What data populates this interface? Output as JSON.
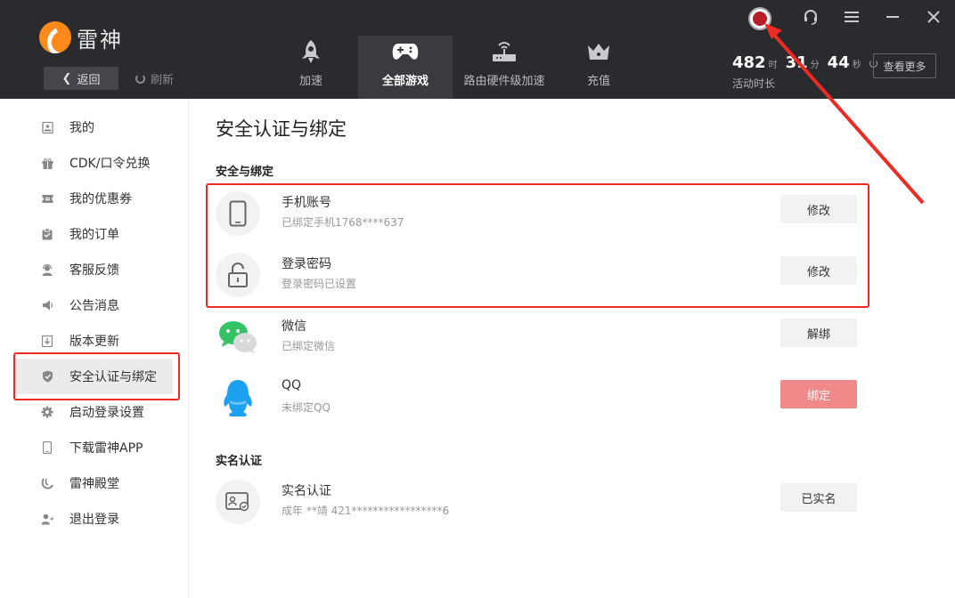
{
  "header": {
    "brand_name": "雷神",
    "back_label": "返回",
    "refresh_label": "刷新",
    "nav": [
      {
        "label": "加速",
        "icon": "rocket-icon"
      },
      {
        "label": "全部游戏",
        "icon": "gamepad-icon",
        "active": true
      },
      {
        "label": "路由硬件级加速",
        "icon": "router-icon"
      },
      {
        "label": "充值",
        "icon": "crown-icon"
      }
    ],
    "stats": {
      "hours": "482",
      "hours_unit": "时",
      "minutes": "31",
      "minutes_unit": "分",
      "seconds": "44",
      "seconds_unit": "秒",
      "label": "活动时长"
    },
    "more_label": "查看更多"
  },
  "sidebar": {
    "items": [
      {
        "label": "我的",
        "icon": "profile-icon"
      },
      {
        "label": "CDK/口令兑换",
        "icon": "gift-icon"
      },
      {
        "label": "我的优惠券",
        "icon": "coupon-icon"
      },
      {
        "label": "我的订单",
        "icon": "order-icon"
      },
      {
        "label": "客服反馈",
        "icon": "support-icon"
      },
      {
        "label": "公告消息",
        "icon": "speaker-icon"
      },
      {
        "label": "版本更新",
        "icon": "update-icon"
      },
      {
        "label": "安全认证与绑定",
        "icon": "shield-icon",
        "active": true
      },
      {
        "label": "启动登录设置",
        "icon": "gear-icon"
      },
      {
        "label": "下载雷神APP",
        "icon": "phone-icon"
      },
      {
        "label": "雷神殿堂",
        "icon": "leishen-logo-icon"
      },
      {
        "label": "退出登录",
        "icon": "logout-icon"
      }
    ]
  },
  "main": {
    "title": "安全认证与绑定",
    "section_security": "安全与绑定",
    "phone": {
      "title": "手机账号",
      "sub": "已绑定手机1768****637",
      "button": "修改"
    },
    "password": {
      "title": "登录密码",
      "sub": "登录密码已设置",
      "button": "修改"
    },
    "wechat": {
      "title": "微信",
      "sub": "已绑定微信",
      "button": "解绑"
    },
    "qq": {
      "title": "QQ",
      "sub": "未绑定QQ",
      "button": "绑定"
    },
    "section_realname": "实名认证",
    "realname": {
      "title": "实名认证",
      "sub": "成年 **靖 421*****************6",
      "button": "已实名"
    }
  },
  "colors": {
    "header_bg": "#2a2b2f",
    "accent_orange": "#ff8a1c",
    "annotation_red": "#ee2a24",
    "bind_button": "#f08a8a"
  }
}
